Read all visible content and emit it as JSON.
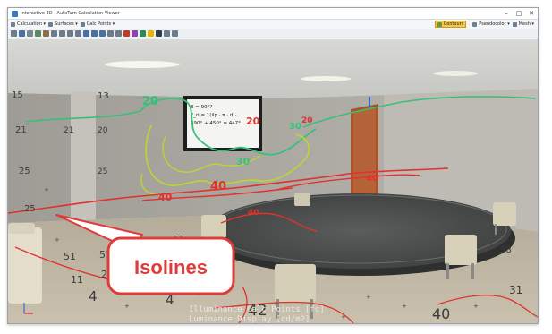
{
  "window": {
    "title": "Interactive 3D - AutoTurn Calculation Viewer",
    "controls": [
      "–",
      "□",
      "✕"
    ]
  },
  "menubar": {
    "calculation": "Calculation",
    "surfaces": "Surfaces",
    "calc_points": "Calc Points",
    "contours": "Contours",
    "pseudocolor": "Pseudocolor",
    "mesh": "Mesh"
  },
  "whiteboard": {
    "lines": [
      "E = 90°?",
      "F_ri = 1(ilp · π · d)·",
      "390° + 450° = 447°"
    ]
  },
  "isolines_callout": {
    "label": "Isolines"
  },
  "viewport_footer": {
    "line1": "Illuminance Calc Points [fc]",
    "line2": "Luminance Display [cd/m2]"
  },
  "isoline_labels": [
    "20",
    "20",
    "30",
    "30",
    "40",
    "40",
    "40",
    "40",
    "20"
  ],
  "grid_values": [
    "15",
    "13",
    "21",
    "25",
    "25",
    "20",
    "21",
    "25",
    "51",
    "51",
    "11",
    "24",
    "11",
    "4",
    "4",
    "42",
    "31",
    "38",
    "40"
  ],
  "colors": {
    "isoline_red": "#e0322f",
    "isoline_green": "#38c07a",
    "isoline_yellowgreen": "#b9d338",
    "isoline_blue": "#2f66d6",
    "callout_fill": "#ffffff",
    "callout_border": "#e03a3a",
    "callout_text": "#e03a3a"
  }
}
